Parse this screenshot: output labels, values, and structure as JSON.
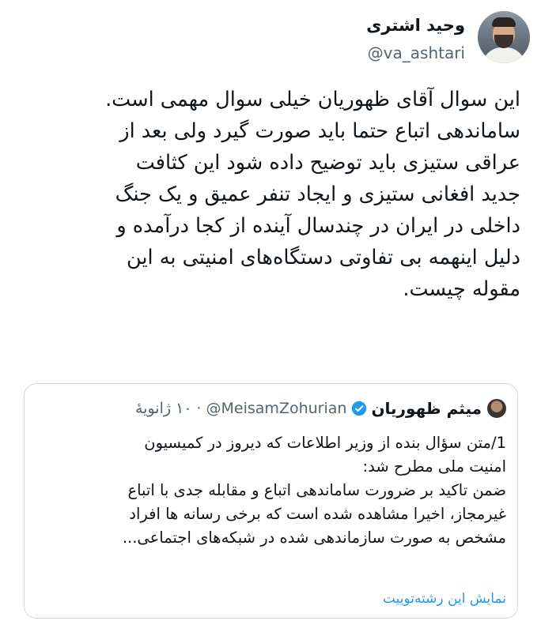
{
  "author": {
    "name": "وحید اشتری",
    "handle": "@va_ashtari"
  },
  "tweet_lines": [
    "این سوال آقای ظهوریان خیلی سوال مهمی است.",
    "ساماندهی اتباع حتما باید صورت گیرد ولی بعد از",
    "عراقی ستیزی باید توضیح داده شود این کثافت",
    "جدید افغانی ستیزی و ایجاد تنفر عمیق و یک جنگ",
    "داخلی در ایران در چندسال آینده از کجا درآمده و",
    "دلیل اینهمه بی تفاوتی دستگاه‌های امنیتی به این",
    "مقوله چیست."
  ],
  "quoted": {
    "name": "میثم ظهوریان",
    "handle": "@MeisamZohurian",
    "date": "۱۰ ژانویهٔ",
    "lines": [
      "1/متن سؤال بنده از وزیر اطلاعات که دیروز در کمیسیون",
      "امنیت ملی مطرح شد:",
      "ضمن تاکید بر ضرورت ساماندهی اتباع و مقابله جدی با اتباع",
      "غیرمجاز، اخیرا مشاهده شده است که برخی رسانه ها افراد",
      "مشخص به صورت سازماندهی شده در شبکه‌های اجتماعی..."
    ],
    "show_thread": "نمایش این رشته‌توییت"
  },
  "colors": {
    "link": "#1d9bf0",
    "muted": "#536471",
    "border": "#cfd9de"
  }
}
